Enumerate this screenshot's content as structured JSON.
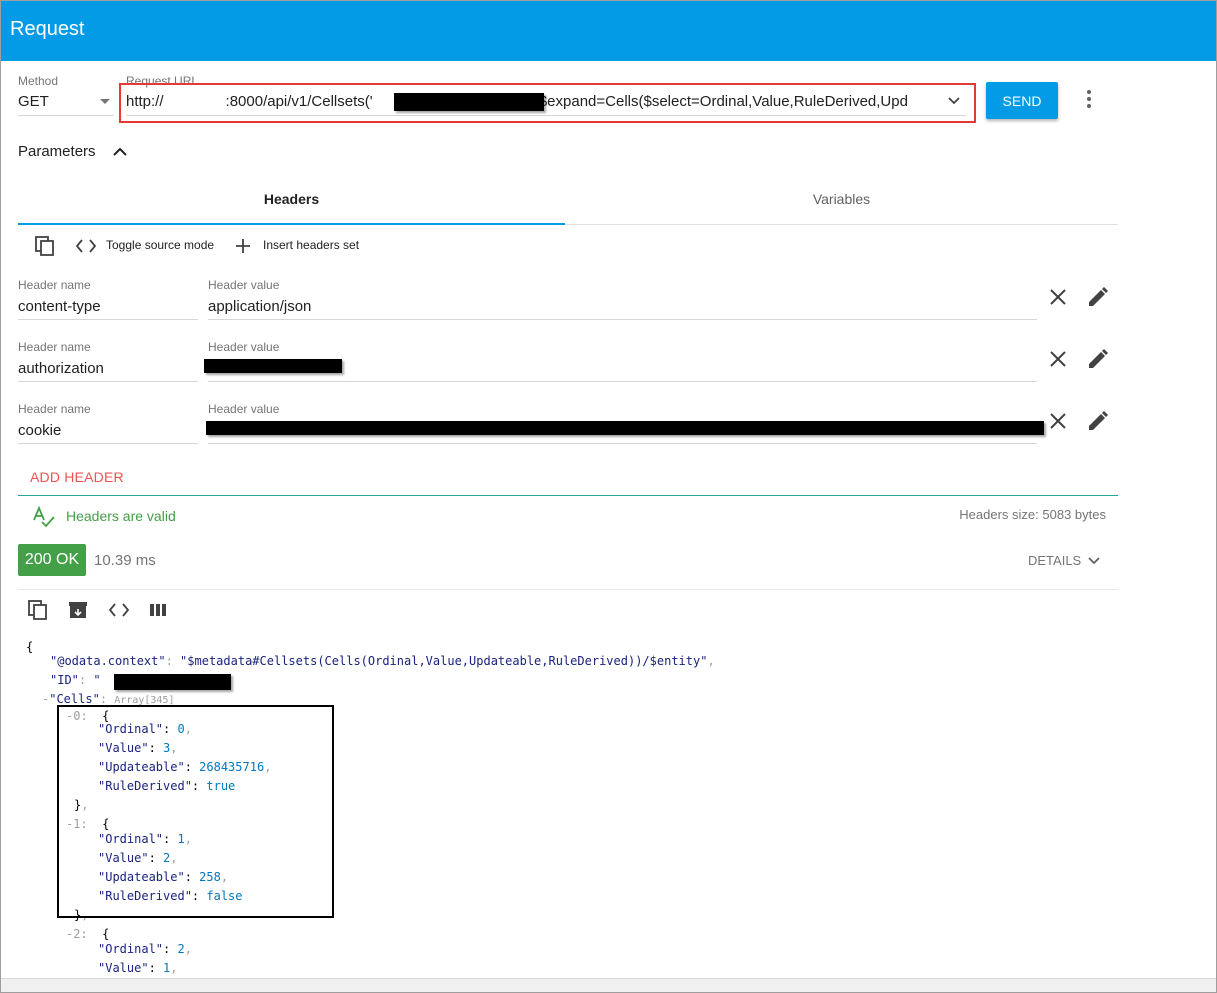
{
  "app": {
    "title": "Request"
  },
  "request": {
    "method_label": "Method",
    "method_value": "GET",
    "url_label": "Request URL",
    "url_prefix": "http://",
    "url_middle": ":8000/api/v1/Cellsets('",
    "url_suffix": "')?$expand=Cells($select=Ordinal,Value,RuleDerived,Upd",
    "send_label": "SEND"
  },
  "parameters": {
    "label": "Parameters",
    "tabs": [
      {
        "label": "Headers"
      },
      {
        "label": "Variables"
      }
    ],
    "toolbar": {
      "toggle_label": "Toggle source mode",
      "insert_label": "Insert headers set"
    },
    "headers": [
      {
        "name_label": "Header name",
        "name": "content-type",
        "value_label": "Header value",
        "value": "application/json"
      },
      {
        "name_label": "Header name",
        "name": "authorization",
        "value_label": "Header value",
        "value": ""
      },
      {
        "name_label": "Header name",
        "name": "cookie",
        "value_label": "Header value",
        "value": ""
      }
    ],
    "add_header_label": "ADD HEADER",
    "valid_text": "Headers are valid",
    "size_text": "Headers size: 5083 bytes"
  },
  "response": {
    "status": "200 OK",
    "time": "10.39 ms",
    "details_label": "DETAILS"
  },
  "json": {
    "open_brace": "{",
    "context_key": "\"@odata.context\"",
    "context_value": "\"$metadata#Cellsets(Cells(Ordinal,Value,Updateable,RuleDerived))/$entity\"",
    "id_key": "\"ID\"",
    "id_quote": "\"",
    "cells_key": "\"Cells\"",
    "cells_type": "Array[345]",
    "items": [
      {
        "index": "0:",
        "ordinal": "0",
        "value": "3",
        "updateable": "268435716",
        "rule_derived": "true"
      },
      {
        "index": "1:",
        "ordinal": "1",
        "value": "2",
        "updateable": "258",
        "rule_derived": "false"
      },
      {
        "index": "2:",
        "ordinal": "2",
        "value": "1"
      }
    ],
    "ordinal_key": "\"Ordinal\"",
    "value_key": "\"Value\"",
    "updateable_key": "\"Updateable\"",
    "rule_key": "\"RuleDerived\""
  }
}
